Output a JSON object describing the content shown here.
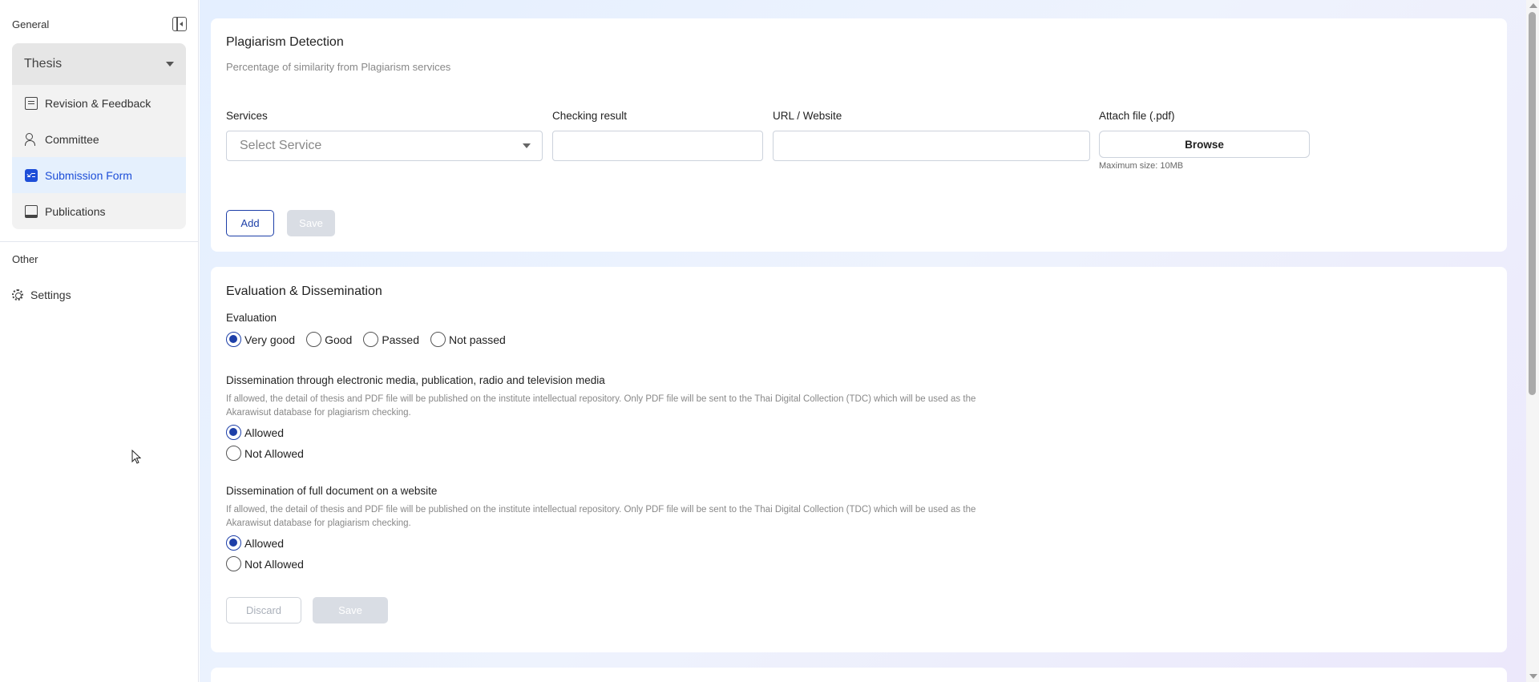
{
  "sidebar": {
    "general_title": "General",
    "other_title": "Other",
    "group_title": "Thesis",
    "items": [
      {
        "label": "Revision & Feedback",
        "icon": "book-icon"
      },
      {
        "label": "Committee",
        "icon": "users-icon"
      },
      {
        "label": "Submission Form",
        "icon": "form-check-icon",
        "active": true
      },
      {
        "label": "Publications",
        "icon": "publication-icon"
      }
    ],
    "settings_label": "Settings"
  },
  "plagiarism": {
    "title": "Plagiarism Detection",
    "subtitle": "Percentage of similarity from Plagiarism services",
    "services_label": "Services",
    "services_placeholder": "Select Service",
    "checking_label": "Checking result",
    "checking_value": "",
    "url_label": "URL / Website",
    "url_value": "",
    "attach_label": "Attach file (.pdf)",
    "browse_label": "Browse",
    "max_size": "Maximum size: 10MB",
    "add_label": "Add",
    "save_label": "Save"
  },
  "evaluation": {
    "title": "Evaluation & Dissemination",
    "eval_label": "Evaluation",
    "eval_options": [
      "Very good",
      "Good",
      "Passed",
      "Not passed"
    ],
    "eval_selected": "Very good",
    "diss1_title": "Dissemination through electronic media, publication, radio and television media",
    "diss1_desc": "If allowed, the detail of thesis and PDF file will be published on the institute intellectual repository. Only PDF file will be sent to the Thai Digital Collection (TDC) which will be used as the Akarawisut database for plagiarism checking.",
    "diss1_options": [
      "Allowed",
      "Not Allowed"
    ],
    "diss1_selected": "Allowed",
    "diss2_title": "Dissemination of full document on a website",
    "diss2_desc": "If allowed, the detail of thesis and PDF file will be published on the institute intellectual repository. Only PDF file will be sent to the Thai Digital Collection (TDC) which will be used as the Akarawisut database for plagiarism checking.",
    "diss2_options": [
      "Allowed",
      "Not Allowed"
    ],
    "diss2_selected": "Allowed",
    "discard_label": "Discard",
    "save_label": "Save"
  },
  "colors": {
    "primary": "#1d3fa8",
    "active_nav_bg": "#e5f0fd",
    "active_nav_text": "#1d4ed8"
  }
}
